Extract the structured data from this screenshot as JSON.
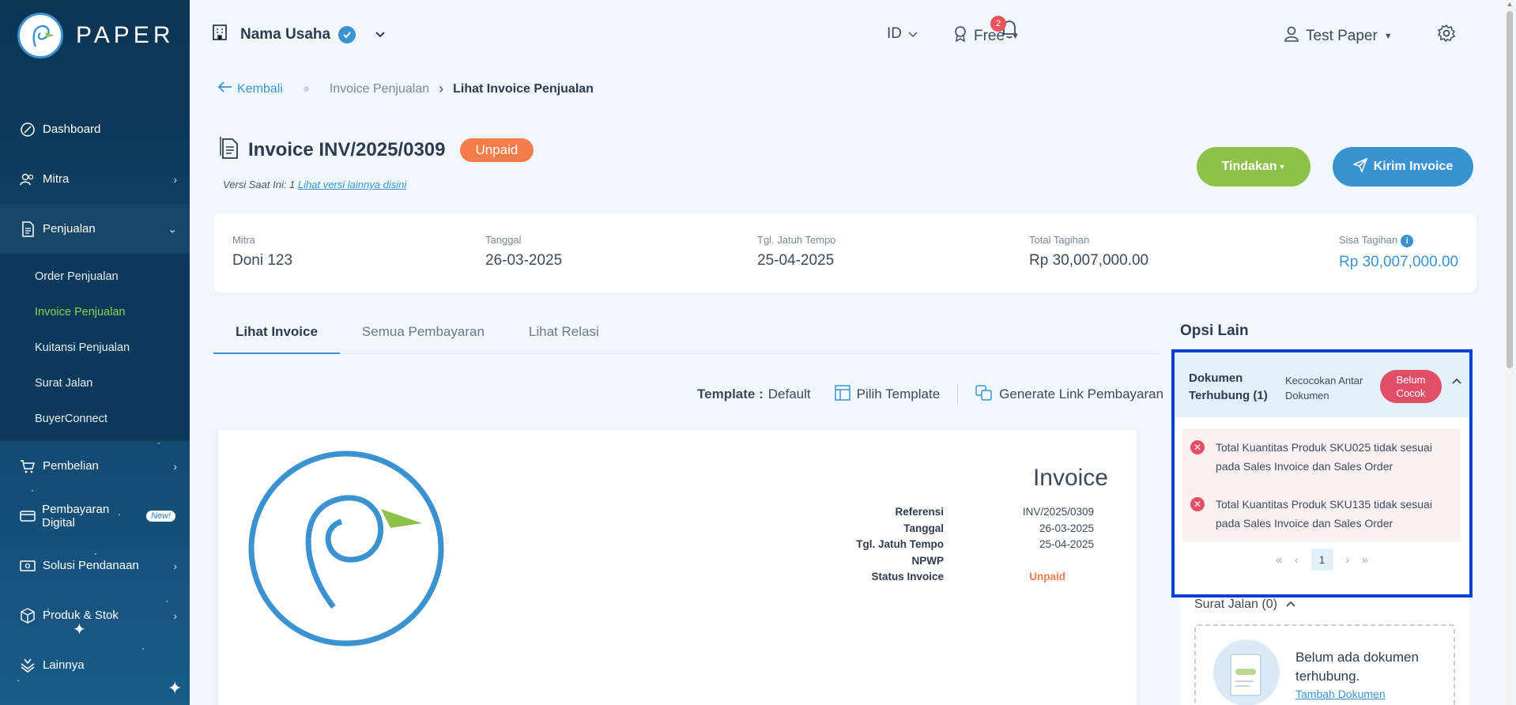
{
  "brand": {
    "name": "PAPER"
  },
  "sidebar": {
    "items": [
      {
        "label": "Dashboard",
        "icon": "leaf-icon"
      },
      {
        "label": "Mitra",
        "icon": "users-icon",
        "chevron": "›"
      },
      {
        "label": "Penjualan",
        "icon": "document-icon",
        "chevron": "⌄"
      },
      {
        "label": "Pembelian",
        "icon": "cart-icon",
        "chevron": "›"
      },
      {
        "label": "Pembayaran Digital",
        "icon": "card-icon",
        "badge": "New!"
      },
      {
        "label": "Solusi Pendanaan",
        "icon": "money-icon",
        "chevron": "›"
      },
      {
        "label": "Produk & Stok",
        "icon": "box-icon",
        "chevron": "›"
      },
      {
        "label": "Lainnya",
        "icon": "layers-icon"
      }
    ],
    "penjualan_sub": [
      "Order Penjualan",
      "Invoice Penjualan",
      "Kuitansi Penjualan",
      "Surat Jalan",
      "BuyerConnect"
    ]
  },
  "topbar": {
    "business": "Nama Usaha",
    "notifications": "2",
    "lang": "ID",
    "plan": "Free",
    "user": "Test Paper"
  },
  "breadcrumb": {
    "back": "Kembali",
    "parent": "Invoice Penjualan",
    "separator": "›",
    "current": "Lihat Invoice Penjualan"
  },
  "invoice_header": {
    "title": "Invoice INV/2025/0309",
    "status": "Unpaid",
    "version_prefix": "Versi Saat Ini: 1",
    "version_link": "Lihat versi lainnya disini",
    "btn_tindakan": "Tindakan",
    "btn_kirim": "Kirim Invoice"
  },
  "summary": {
    "mitra_label": "Mitra",
    "mitra": "Doni 123",
    "tanggal_label": "Tanggal",
    "tanggal": "26-03-2025",
    "jatuh_tempo_label": "Tgl. Jatuh Tempo",
    "jatuh_tempo": "25-04-2025",
    "total_label": "Total Tagihan",
    "total": "Rp 30,007,000.00",
    "sisa_label": "Sisa Tagihan",
    "sisa": "Rp 30,007,000.00"
  },
  "tabs": [
    "Lihat Invoice",
    "Semua Pembayaran",
    "Lihat Relasi"
  ],
  "template_bar": {
    "label": "Template :",
    "value": "Default",
    "pilih": "Pilih Template",
    "generate": "Generate Link Pembayaran"
  },
  "preview": {
    "title": "Invoice",
    "rows": [
      {
        "k": "Referensi",
        "v": "INV/2025/0309"
      },
      {
        "k": "Tanggal",
        "v": "26-03-2025"
      },
      {
        "k": "Tgl. Jatuh Tempo",
        "v": "25-04-2025"
      },
      {
        "k": "NPWP",
        "v": ""
      },
      {
        "k": "Status Invoice",
        "v": "Unpaid"
      }
    ]
  },
  "opsi": {
    "title": "Opsi Lain",
    "doc_title_1": "Dokumen",
    "doc_title_2": "Terhubung (1)",
    "match_1": "Kecocokan Antar",
    "match_2": "Dokumen",
    "match_status_1": "Belum",
    "match_status_2": "Cocok",
    "errors": [
      "Total Kuantitas Produk SKU025 tidak sesuai pada Sales Invoice dan Sales Order",
      "Total Kuantitas Produk SKU135 tidak sesuai pada Sales Invoice dan Sales Order"
    ],
    "pager": {
      "first": "«",
      "prev": "‹",
      "page": "1",
      "next": "›",
      "last": "»"
    },
    "surat_jalan": "Surat Jalan (0)",
    "empty_msg": "Belum ada dokumen terhubung.",
    "add_doc": "Tambah Dokumen"
  },
  "colors": {
    "accent": "#3a93d0",
    "green": "#8fc04a",
    "unpaid": "#f47c4a",
    "error": "#e14f67",
    "highlight": "#0a3fd6"
  }
}
